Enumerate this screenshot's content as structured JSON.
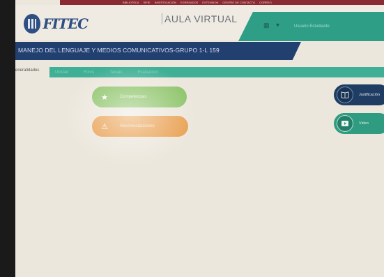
{
  "top_nav": [
    "BIBLIOTECA",
    "SIFIE",
    "INVESTIGACION",
    "EGRESADOS",
    "EXTENSION",
    "CENTRO DE CONTACTO",
    "CORREO"
  ],
  "logo": {
    "text": "FITEC"
  },
  "header": {
    "title": "AULA VIRTUAL",
    "user_name": "Usuario Estudiante"
  },
  "course": {
    "title": "MANEJO DEL LENGUAJE Y MEDIOS COMUNICATIVOS-GRUPO 1-L 159"
  },
  "tabs": {
    "active": "eneralidades",
    "others": [
      "Unidad",
      "Foros",
      "Tareas",
      "Evaluacion"
    ]
  },
  "buttons": {
    "competencias": "Competencias",
    "recomendaciones": "Recomendaciones",
    "justificacion": "Justificación",
    "video": "Video"
  },
  "colors": {
    "navy": "#213f6f",
    "teal": "#2e9f86",
    "green": "#8ec46a",
    "orange": "#e9a153",
    "nav_red": "#8a2a32"
  }
}
